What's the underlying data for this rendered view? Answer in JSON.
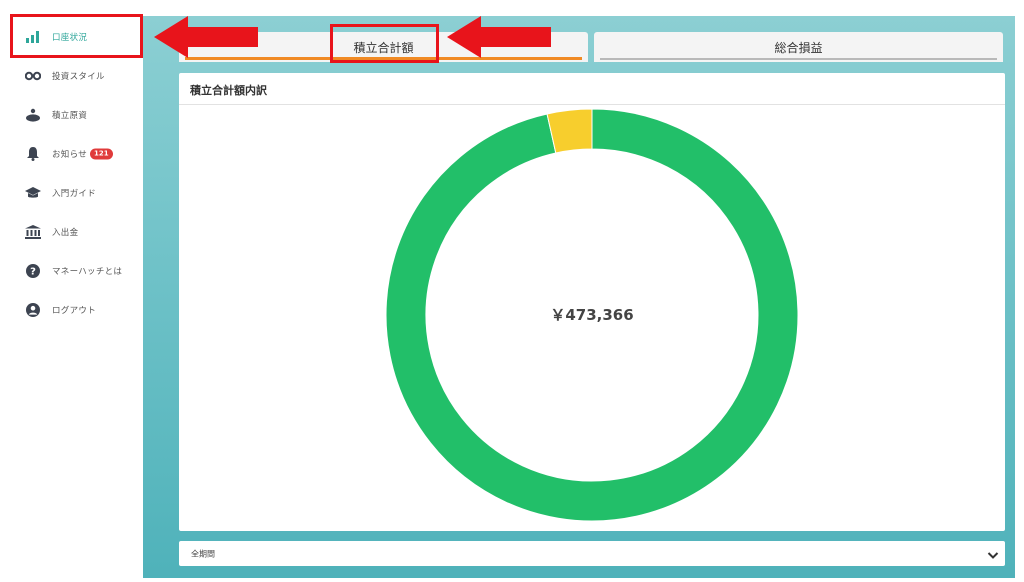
{
  "sidebar": {
    "items": [
      {
        "label": "口座状況",
        "icon": "bar-chart-icon",
        "active": true
      },
      {
        "label": "投資スタイル",
        "icon": "glasses-icon"
      },
      {
        "label": "積立原資",
        "icon": "piggy-bank-icon"
      },
      {
        "label": "お知らせ",
        "icon": "bell-icon",
        "badge": "121"
      },
      {
        "label": "入門ガイド",
        "icon": "graduation-cap-icon"
      },
      {
        "label": "入出金",
        "icon": "bank-icon"
      },
      {
        "label": "マネーハッチとは",
        "icon": "question-circle-icon"
      },
      {
        "label": "ログアウト",
        "icon": "user-circle-icon"
      }
    ]
  },
  "tabs": [
    {
      "label": "積立合計額",
      "active": true
    },
    {
      "label": "総合損益",
      "active": false
    }
  ],
  "card": {
    "title": "積立合計額内訳",
    "total": "￥473,366"
  },
  "chart_data": {
    "type": "pie",
    "style": "donut",
    "center_label": "￥473,366",
    "series": [
      {
        "share": 0.965,
        "color": "#22bf69"
      },
      {
        "share": 0.035,
        "color": "#f7ce2d"
      }
    ]
  },
  "period_select": {
    "value": "全期間"
  },
  "colors": {
    "accent": "#2ea69a",
    "tab_underline": "#f08a24",
    "highlight": "#e8141b"
  }
}
